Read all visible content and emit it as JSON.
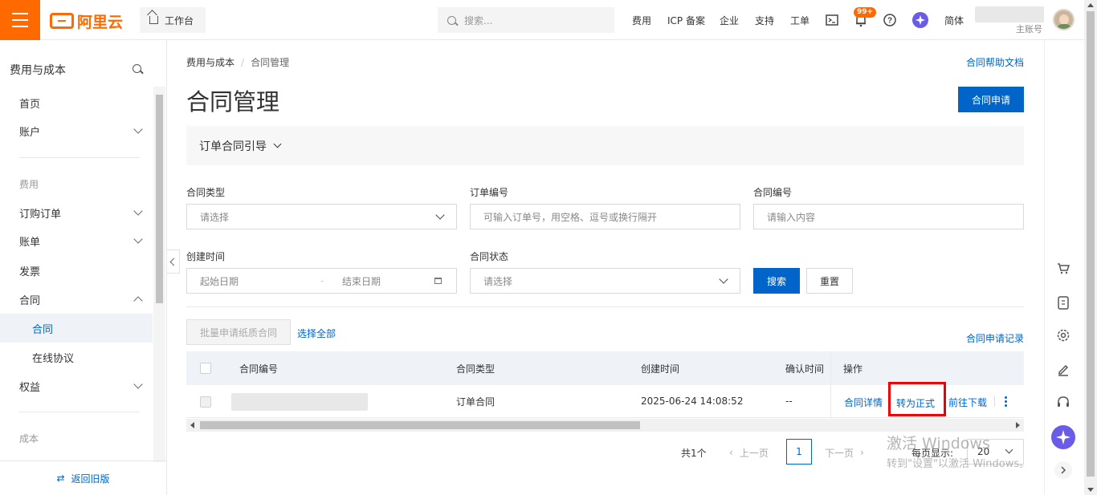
{
  "header": {
    "logo_text": "阿里云",
    "workbench": "工作台",
    "search_placeholder": "搜索...",
    "nav": [
      "费用",
      "ICP 备案",
      "企业",
      "支持",
      "工单"
    ],
    "badge": "99+",
    "language": "简体",
    "account_suffix": "主账号"
  },
  "sidebar": {
    "title": "费用与成本",
    "items": [
      {
        "label": "首页"
      },
      {
        "label": "账户"
      },
      {
        "label": "费用"
      },
      {
        "label": "订购订单"
      },
      {
        "label": "账单"
      },
      {
        "label": "发票"
      },
      {
        "label": "合同"
      },
      {
        "label": "合同"
      },
      {
        "label": "在线协议"
      },
      {
        "label": "权益"
      },
      {
        "label": "成本"
      }
    ],
    "back_label": "返回旧版"
  },
  "breadcrumb": {
    "root": "费用与成本",
    "current": "合同管理"
  },
  "help_link": "合同帮助文档",
  "page_title": "合同管理",
  "apply_button": "合同申请",
  "guide": "订单合同引导",
  "filters": {
    "contract_type": {
      "label": "合同类型",
      "placeholder": "请选择"
    },
    "order_no": {
      "label": "订单编号",
      "placeholder": "可输入订单号，用空格、逗号或换行隔开"
    },
    "contract_no": {
      "label": "合同编号",
      "placeholder": "请输入内容"
    },
    "created_time": {
      "label": "创建时间",
      "start": "起始日期",
      "end": "结束日期",
      "sep": "-"
    },
    "status": {
      "label": "合同状态",
      "placeholder": "请选择"
    },
    "search": "搜索",
    "reset": "重置"
  },
  "actions": {
    "batch": "批量申请纸质合同",
    "select_all": "选择全部",
    "records": "合同申请记录"
  },
  "table": {
    "columns": [
      "合同编号",
      "合同类型",
      "创建时间",
      "确认时间",
      "操作"
    ],
    "rows": [
      {
        "type": "订单合同",
        "created": "2025-06-24 14:08:52",
        "confirmed": "--",
        "ops": [
          "合同详情",
          "转为正式",
          "前往下载"
        ]
      }
    ]
  },
  "pagination": {
    "total": "共1个",
    "prev": "上一页",
    "page": "1",
    "next": "下一页",
    "per_page_label": "每页显示:",
    "per_page": "20"
  },
  "watermark": {
    "line1": "激活 Windows",
    "line2": "转到\"设置\"以激活 Windows。"
  },
  "colors": {
    "brand": "#ff6a00",
    "primary": "#0064c8",
    "highlight": "#e00000"
  }
}
